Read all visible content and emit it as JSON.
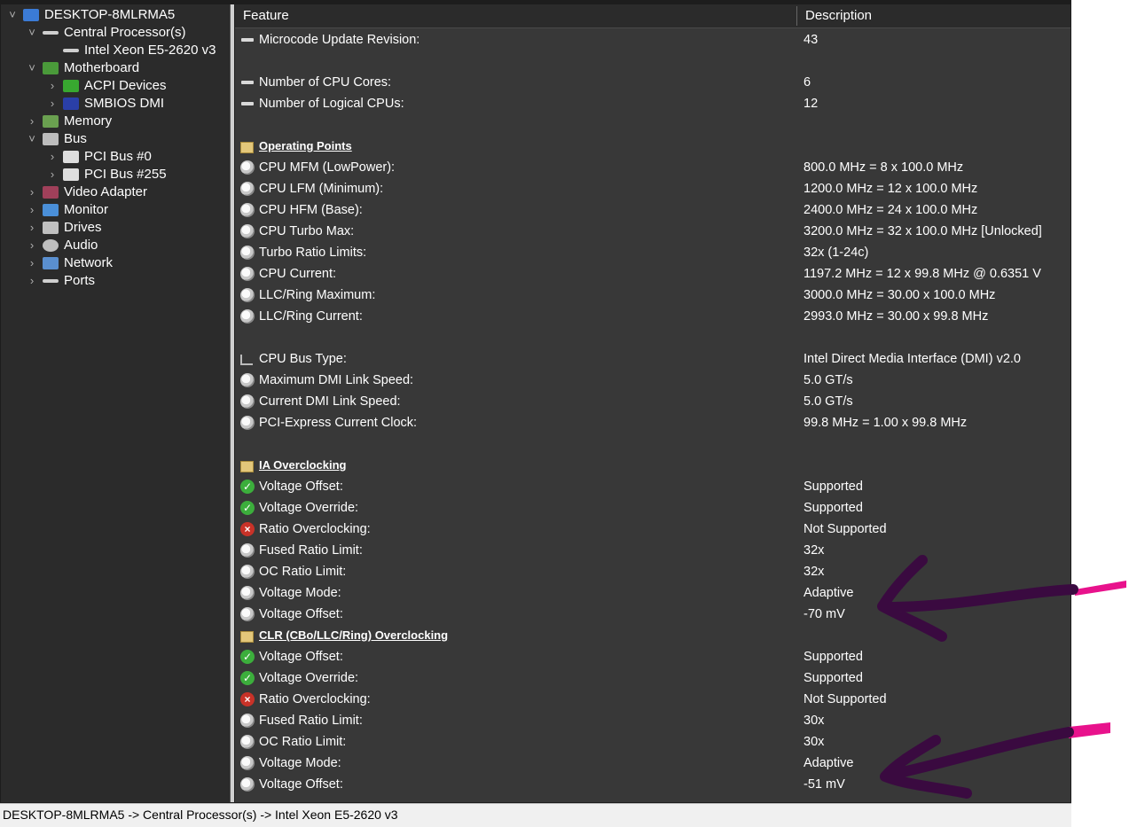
{
  "tree": {
    "items": [
      {
        "label": "DESKTOP-8MLRMA5",
        "level": 0,
        "chev": "v",
        "icon": "computer-icon"
      },
      {
        "label": "Central Processor(s)",
        "level": 1,
        "chev": "v",
        "icon": "cpu-icon"
      },
      {
        "label": "Intel Xeon E5-2620 v3",
        "level": 2,
        "chev": "",
        "icon": "cpu-icon"
      },
      {
        "label": "Motherboard",
        "level": 1,
        "chev": "v",
        "icon": "motherboard-icon"
      },
      {
        "label": "ACPI Devices",
        "level": 2,
        "chev": ">",
        "icon": "battery-icon"
      },
      {
        "label": "SMBIOS DMI",
        "level": 2,
        "chev": ">",
        "icon": "dmi-icon"
      },
      {
        "label": "Memory",
        "level": 1,
        "chev": ">",
        "icon": "memory-icon"
      },
      {
        "label": "Bus",
        "level": 1,
        "chev": "v",
        "icon": "bus-icon"
      },
      {
        "label": "PCI Bus #0",
        "level": 2,
        "chev": ">",
        "icon": "pci-icon"
      },
      {
        "label": "PCI Bus #255",
        "level": 2,
        "chev": ">",
        "icon": "pci-icon"
      },
      {
        "label": "Video Adapter",
        "level": 1,
        "chev": ">",
        "icon": "video-adapter-icon"
      },
      {
        "label": "Monitor",
        "level": 1,
        "chev": ">",
        "icon": "monitor-icon"
      },
      {
        "label": "Drives",
        "level": 1,
        "chev": ">",
        "icon": "drive-icon"
      },
      {
        "label": "Audio",
        "level": 1,
        "chev": ">",
        "icon": "speaker-icon"
      },
      {
        "label": "Network",
        "level": 1,
        "chev": ">",
        "icon": "network-icon"
      },
      {
        "label": "Ports",
        "level": 1,
        "chev": ">",
        "icon": "port-icon"
      }
    ]
  },
  "table": {
    "col_feature": "Feature",
    "col_description": "Description",
    "rows": [
      {
        "type": "item",
        "icon": "chip",
        "feature": "Microcode Update Revision:",
        "desc": "43"
      },
      {
        "type": "blank"
      },
      {
        "type": "item",
        "icon": "chip",
        "feature": "Number of CPU Cores:",
        "desc": "6"
      },
      {
        "type": "item",
        "icon": "chip",
        "feature": "Number of Logical CPUs:",
        "desc": "12"
      },
      {
        "type": "blank"
      },
      {
        "type": "section",
        "icon": "folder",
        "feature": "Operating Points",
        "desc": ""
      },
      {
        "type": "item",
        "icon": "disc",
        "feature": "CPU MFM (LowPower):",
        "desc": "800.0 MHz = 8 x 100.0 MHz"
      },
      {
        "type": "item",
        "icon": "disc",
        "feature": "CPU LFM (Minimum):",
        "desc": "1200.0 MHz = 12 x 100.0 MHz"
      },
      {
        "type": "item",
        "icon": "disc",
        "feature": "CPU HFM (Base):",
        "desc": "2400.0 MHz = 24 x 100.0 MHz"
      },
      {
        "type": "item",
        "icon": "disc",
        "feature": "CPU Turbo Max:",
        "desc": "3200.0 MHz = 32 x 100.0 MHz [Unlocked]"
      },
      {
        "type": "item",
        "icon": "disc",
        "feature": "Turbo Ratio Limits:",
        "desc": "32x (1-24c)"
      },
      {
        "type": "item",
        "icon": "disc",
        "feature": "CPU Current:",
        "desc": "1197.2 MHz = 12 x 99.8 MHz @ 0.6351 V"
      },
      {
        "type": "item",
        "icon": "disc",
        "feature": "LLC/Ring Maximum:",
        "desc": "3000.0 MHz = 30.00 x 100.0 MHz"
      },
      {
        "type": "item",
        "icon": "disc",
        "feature": "LLC/Ring Current:",
        "desc": "2993.0 MHz = 30.00 x 99.8 MHz"
      },
      {
        "type": "blank"
      },
      {
        "type": "item",
        "icon": "bus",
        "feature": "CPU Bus Type:",
        "desc": "Intel Direct Media Interface (DMI) v2.0"
      },
      {
        "type": "item",
        "icon": "disc",
        "feature": "Maximum DMI Link Speed:",
        "desc": "5.0 GT/s"
      },
      {
        "type": "item",
        "icon": "disc",
        "feature": "Current DMI Link Speed:",
        "desc": "5.0 GT/s"
      },
      {
        "type": "item",
        "icon": "disc",
        "feature": "PCI-Express Current Clock:",
        "desc": "99.8 MHz = 1.00 x 99.8 MHz"
      },
      {
        "type": "blank"
      },
      {
        "type": "section",
        "icon": "folder",
        "feature": "IA Overclocking",
        "desc": ""
      },
      {
        "type": "item",
        "icon": "ok",
        "feature": "Voltage Offset:",
        "desc": "Supported"
      },
      {
        "type": "item",
        "icon": "ok",
        "feature": "Voltage Override:",
        "desc": "Supported"
      },
      {
        "type": "item",
        "icon": "no",
        "feature": "Ratio Overclocking:",
        "desc": "Not Supported"
      },
      {
        "type": "item",
        "icon": "disc",
        "feature": "Fused Ratio Limit:",
        "desc": "32x"
      },
      {
        "type": "item",
        "icon": "disc",
        "feature": "OC Ratio Limit:",
        "desc": "32x"
      },
      {
        "type": "item",
        "icon": "disc",
        "feature": "Voltage Mode:",
        "desc": "Adaptive"
      },
      {
        "type": "item",
        "icon": "disc",
        "feature": "Voltage Offset:",
        "desc": "-70 mV"
      },
      {
        "type": "section",
        "icon": "folder",
        "feature": "CLR (CBo/LLC/Ring) Overclocking",
        "desc": ""
      },
      {
        "type": "item",
        "icon": "ok",
        "feature": "Voltage Offset:",
        "desc": "Supported"
      },
      {
        "type": "item",
        "icon": "ok",
        "feature": "Voltage Override:",
        "desc": "Supported"
      },
      {
        "type": "item",
        "icon": "no",
        "feature": "Ratio Overclocking:",
        "desc": "Not Supported"
      },
      {
        "type": "item",
        "icon": "disc",
        "feature": "Fused Ratio Limit:",
        "desc": "30x"
      },
      {
        "type": "item",
        "icon": "disc",
        "feature": "OC Ratio Limit:",
        "desc": "30x"
      },
      {
        "type": "item",
        "icon": "disc",
        "feature": "Voltage Mode:",
        "desc": "Adaptive"
      },
      {
        "type": "item",
        "icon": "disc",
        "feature": "Voltage Offset:",
        "desc": "-51 mV"
      }
    ]
  },
  "status": {
    "path": "DESKTOP-8MLRMA5 -> Central Processor(s) -> Intel Xeon E5-2620 v3"
  },
  "colors": {
    "annotation_arrow": "#3a0a40",
    "annotation_highlight": "#e8128c"
  }
}
